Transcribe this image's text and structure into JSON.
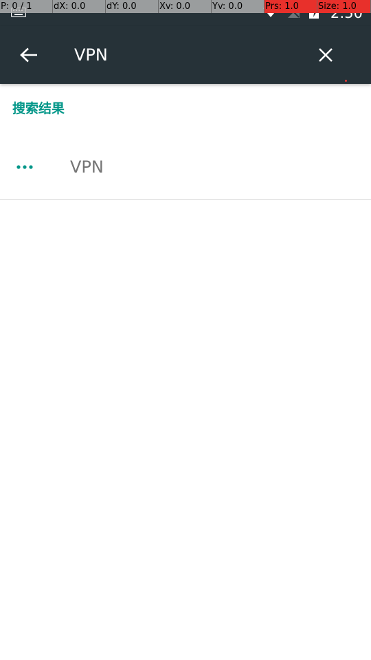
{
  "status_bar": {
    "time": "2:50",
    "icons": [
      "keyboard-icon",
      "wifi-icon",
      "no-signal-icon",
      "battery-charging-icon"
    ]
  },
  "debug_overlay": {
    "cells": [
      {
        "text": "P: 0 / 1",
        "highlight": false
      },
      {
        "text": "dX: 0.0",
        "highlight": false
      },
      {
        "text": "dY: 0.0",
        "highlight": false
      },
      {
        "text": "Xv: 0.0",
        "highlight": false
      },
      {
        "text": "Yv: 0.0",
        "highlight": false
      },
      {
        "text": "Prs: 1.0",
        "highlight": true
      },
      {
        "text": "Size: 1.0",
        "highlight": true
      }
    ]
  },
  "toolbar": {
    "back_icon": "arrow-back-icon",
    "query": "VPN",
    "clear_icon": "close-icon",
    "background_color": "#263238"
  },
  "results": {
    "header": "搜索结果",
    "accent_color": "#009688",
    "items": [
      {
        "icon": "more-horizontal-icon",
        "title": "VPN"
      }
    ]
  }
}
